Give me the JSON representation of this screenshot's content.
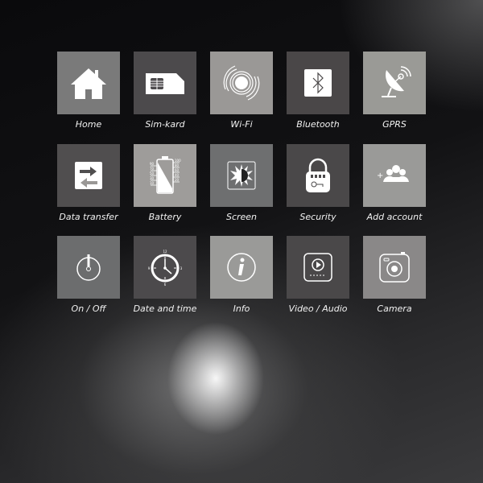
{
  "tiles": [
    {
      "label": "Home",
      "icon": "home-icon",
      "color": "#7a7a7a"
    },
    {
      "label": "Sim-kard",
      "icon": "sim-card-icon",
      "color": "#4c4a4c"
    },
    {
      "label": "Wi-Fi",
      "icon": "wifi-icon",
      "color": "#9a9896"
    },
    {
      "label": "Bluetooth",
      "icon": "bluetooth-icon",
      "color": "#4a4748"
    },
    {
      "label": "GPRS",
      "icon": "satellite-dish-icon",
      "color": "#9a9a96"
    },
    {
      "label": "Data transfer",
      "icon": "data-transfer-icon",
      "color": "#504e4f"
    },
    {
      "label": "Battery",
      "icon": "battery-icon",
      "color": "#9e9c9a"
    },
    {
      "label": "Screen",
      "icon": "screen-brightness-icon",
      "color": "#6e6f70"
    },
    {
      "label": "Security",
      "icon": "lock-icon",
      "color": "#4a4849"
    },
    {
      "label": "Add account",
      "icon": "add-account-icon",
      "color": "#9a9a98"
    },
    {
      "label": "On / Off",
      "icon": "power-icon",
      "color": "#6c6d6e"
    },
    {
      "label": "Date and time",
      "icon": "clock-icon",
      "color": "#4c4a4c"
    },
    {
      "label": "Info",
      "icon": "info-icon",
      "color": "#9a9a98"
    },
    {
      "label": "Video / Audio",
      "icon": "media-player-icon",
      "color": "#4a4849"
    },
    {
      "label": "Camera",
      "icon": "camera-icon",
      "color": "#8a8888"
    }
  ],
  "battery_scale": {
    "left": [
      "90",
      "70",
      "50",
      "30",
      "10"
    ],
    "right": [
      "100",
      "80",
      "60",
      "40",
      "20"
    ]
  },
  "clock_numbers": [
    "12",
    "3",
    "6",
    "9"
  ]
}
